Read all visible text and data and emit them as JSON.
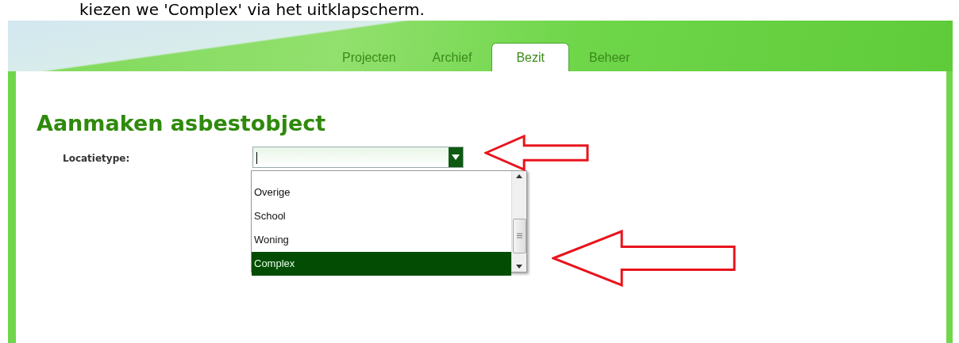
{
  "caption": "kiezen we 'Complex' via het uitklapscherm.",
  "tabs": [
    {
      "label": "Projecten",
      "selected": false
    },
    {
      "label": "Archief",
      "selected": false
    },
    {
      "label": "Bezit",
      "selected": true
    },
    {
      "label": "Beheer",
      "selected": false
    }
  ],
  "title": "Aanmaken asbestobject",
  "field": {
    "label": "Locatietype:",
    "expanded": true,
    "options": [
      {
        "label": "Overige",
        "selected": false
      },
      {
        "label": "School",
        "selected": false
      },
      {
        "label": "Woning",
        "selected": false
      },
      {
        "label": "Complex",
        "selected": true
      }
    ]
  }
}
